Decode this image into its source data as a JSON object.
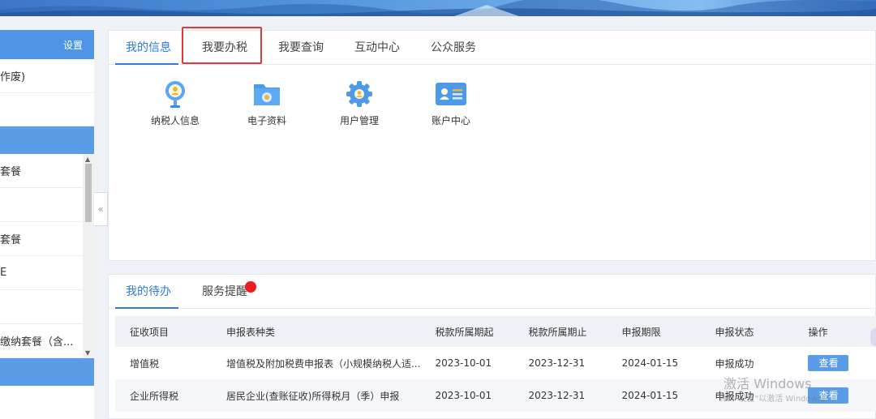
{
  "sidebar": {
    "settings": "设置",
    "item_void": "作废)",
    "list_items": [
      "套餐",
      "",
      "套餐",
      "E",
      "",
      "缴纳套餐（含..."
    ]
  },
  "collapse_icon": "double-chevron-left",
  "top_tabs": [
    "我的信息",
    "我要办税",
    "我要查询",
    "互动中心",
    "公众服务"
  ],
  "shortcuts": [
    {
      "label": "纳税人信息",
      "icon": "taxpayer-icon"
    },
    {
      "label": "电子资料",
      "icon": "folder-icon"
    },
    {
      "label": "用户管理",
      "icon": "gear-icon"
    },
    {
      "label": "账户中心",
      "icon": "id-card-icon"
    }
  ],
  "bottom_tabs": [
    "我的待办",
    "服务提醒"
  ],
  "table": {
    "headers": [
      "征收项目",
      "申报表种类",
      "税款所属期起",
      "税款所属期止",
      "申报期限",
      "申报状态",
      "操作"
    ],
    "rows": [
      [
        "增值税",
        "增值税及附加税费申报表（小规模纳税人适...",
        "2023-10-01",
        "2023-12-31",
        "2024-01-15",
        "申报成功",
        "查看"
      ],
      [
        "企业所得税",
        "居民企业(查账征收)所得税月（季）申报",
        "2023-10-01",
        "2023-12-31",
        "2024-01-15",
        "申报成功",
        "查看"
      ]
    ]
  },
  "watermark": {
    "line1": "激活 Windows",
    "line2": "转到\"设置\"以激活 Windows。"
  },
  "colors": {
    "accent": "#2e7ad9",
    "sidebar_blue": "#5b9ce6",
    "highlight_red": "#e23a3a",
    "badge_red": "#ee1c1c"
  }
}
